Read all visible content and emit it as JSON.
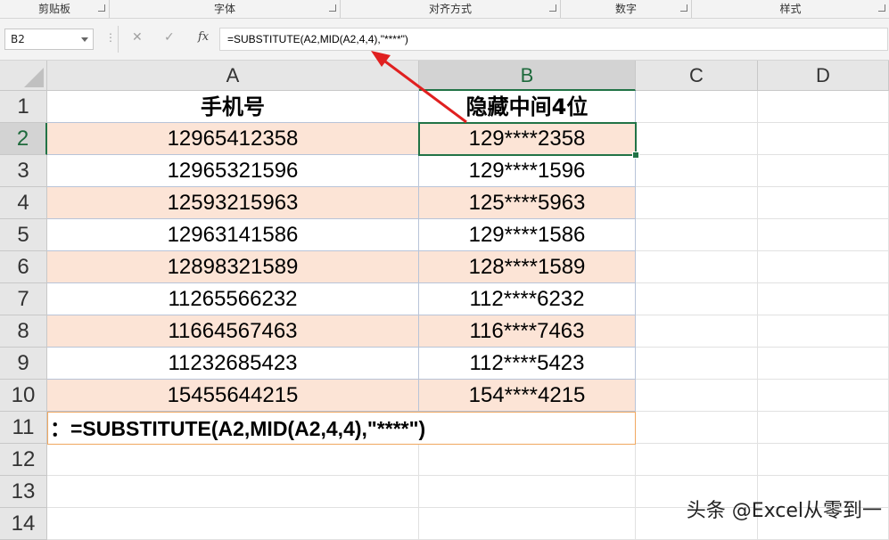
{
  "ribbon": {
    "groups": [
      "剪贴板",
      "字体",
      "对齐方式",
      "数字",
      "样式"
    ]
  },
  "formula_bar": {
    "name_box": "B2",
    "cancel_icon": "✕",
    "enter_icon": "✓",
    "fx_label": "fx",
    "formula": "=SUBSTITUTE(A2,MID(A2,4,4),\"****\")"
  },
  "columns": [
    "A",
    "B",
    "C",
    "D"
  ],
  "rows": [
    "1",
    "2",
    "3",
    "4",
    "5",
    "6",
    "7",
    "8",
    "9",
    "10",
    "11",
    "12",
    "13",
    "14"
  ],
  "table": {
    "header_a": "手机号",
    "header_b": "隐藏中间4位",
    "data": [
      {
        "phone": "12965412358",
        "masked": "129****2358"
      },
      {
        "phone": "12965321596",
        "masked": "129****1596"
      },
      {
        "phone": "12593215963",
        "masked": "125****5963"
      },
      {
        "phone": "12963141586",
        "masked": "129****1586"
      },
      {
        "phone": "12898321589",
        "masked": "128****1589"
      },
      {
        "phone": "11265566232",
        "masked": "112****6232"
      },
      {
        "phone": "11664567463",
        "masked": "116****7463"
      },
      {
        "phone": "11232685423",
        "masked": "112****5423"
      },
      {
        "phone": "15455644215",
        "masked": "154****4215"
      }
    ],
    "note": "：=SUBSTITUTE(A2,MID(A2,4,4),\"****\")"
  },
  "selection": {
    "active_cell": "B2"
  },
  "colors": {
    "accent": "#217346",
    "pink_fill": "#fce4d6",
    "arrow": "#e02020",
    "note_border": "#f0a860"
  },
  "watermark": "头条 @Excel从零到一"
}
